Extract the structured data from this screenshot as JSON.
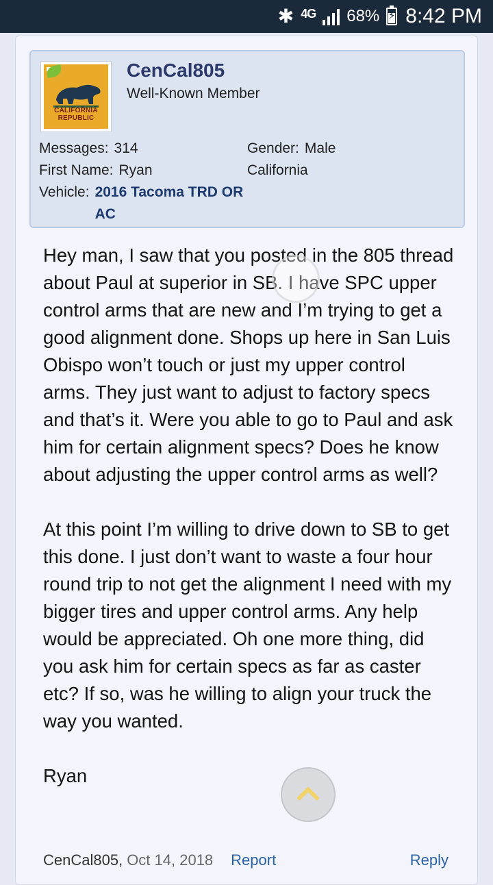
{
  "statusbar": {
    "network": "4G",
    "battery": "68%",
    "battery_level": 0.68,
    "time": "8:42 PM",
    "icons": [
      "bluetooth-icon",
      "network-4g-icon",
      "signal-icon",
      "battery-charging-icon"
    ]
  },
  "user": {
    "name": "CenCal805",
    "title": "Well-Known Member",
    "avatar_caption": "CALIFORNIA REPUBLIC",
    "messages_label": "Messages:",
    "messages": "314",
    "first_name_label": "First Name:",
    "first_name": "Ryan",
    "vehicle_label": "Vehicle:",
    "vehicle": "2016 Tacoma TRD OR AC",
    "gender_label": "Gender:",
    "gender": "Male",
    "location": "California"
  },
  "post": {
    "paragraph1": "Hey man, I saw that you posted in the 805 thread about Paul at superior in SB. I have SPC upper control arms that are new and I’m trying to get a good alignment done. Shops up here in San Luis Obispo won’t touch or just my upper control arms. They just want to adjust to factory specs and that’s it. Were you able to go to Paul and ask him for certain alignment specs? Does he know about adjusting the upper control arms as well?",
    "paragraph2": "At this point I’m willing to drive down to SB to get this done. I just don’t want to waste a four hour round trip to not get the alignment I need with my bigger tires and upper control arms. Any help would be appreciated. Oh one more thing, did you ask him for certain specs as far as caster etc? If so, was he willing to align your truck the way you wanted.",
    "signature": "Ryan"
  },
  "footer": {
    "author": "CenCal805,",
    "date": "Oct 14, 2018",
    "report": "Report",
    "reply": "Reply"
  },
  "colors": {
    "statusbar_bg": "#1b2a3a",
    "username": "#2b3a6b",
    "link": "#2a63a8",
    "userinfo_bg": "#dde4f1"
  }
}
